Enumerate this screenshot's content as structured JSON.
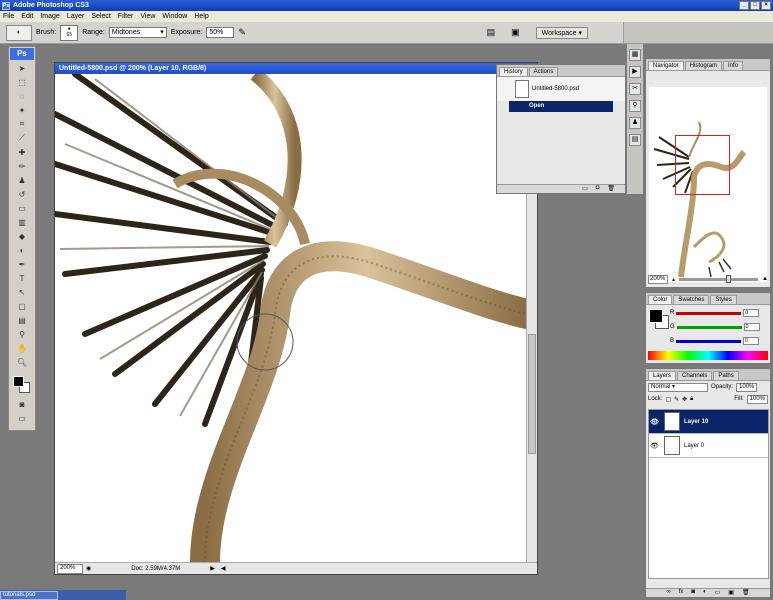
{
  "app": {
    "title": "Adobe Photoshop CS3",
    "logo": "Ps"
  },
  "menu": [
    "File",
    "Edit",
    "Image",
    "Layer",
    "Select",
    "Filter",
    "View",
    "Window",
    "Help"
  ],
  "options": {
    "brush_label": "Brush:",
    "brush_size": "65",
    "range_label": "Range:",
    "range_value": "Midtones",
    "exposure_label": "Exposure:",
    "exposure_value": "50%",
    "workspace_label": "Workspace"
  },
  "document": {
    "title": "Untitled-5800.psd @ 200% (Layer 10, RGB/8)",
    "zoom": "200%",
    "doc_info": "Doc: 2.59M/4.37M"
  },
  "history": {
    "tabs": [
      "History",
      "Actions"
    ],
    "snapshot": "Untitled-5800.psd",
    "steps": [
      "Open"
    ]
  },
  "navigator": {
    "tabs": [
      "Navigator",
      "Histogram",
      "Info"
    ],
    "zoom": "200%"
  },
  "color": {
    "tabs": [
      "Color",
      "Swatches",
      "Styles"
    ],
    "channels": [
      {
        "label": "R",
        "value": "0",
        "color": "#c00000"
      },
      {
        "label": "G",
        "value": "0",
        "color": "#00a000"
      },
      {
        "label": "B",
        "value": "0",
        "color": "#0000c0"
      }
    ]
  },
  "layers": {
    "tabs": [
      "Layers",
      "Channels",
      "Paths"
    ],
    "blend_mode": "Normal",
    "opacity_label": "Opacity:",
    "opacity": "100%",
    "lock_label": "Lock:",
    "fill_label": "Fill:",
    "fill": "100%",
    "items": [
      {
        "name": "Layer 10",
        "selected": true
      },
      {
        "name": "Layer 0",
        "selected": false
      }
    ]
  },
  "taskbar": {
    "task": "tutorials.psd"
  }
}
